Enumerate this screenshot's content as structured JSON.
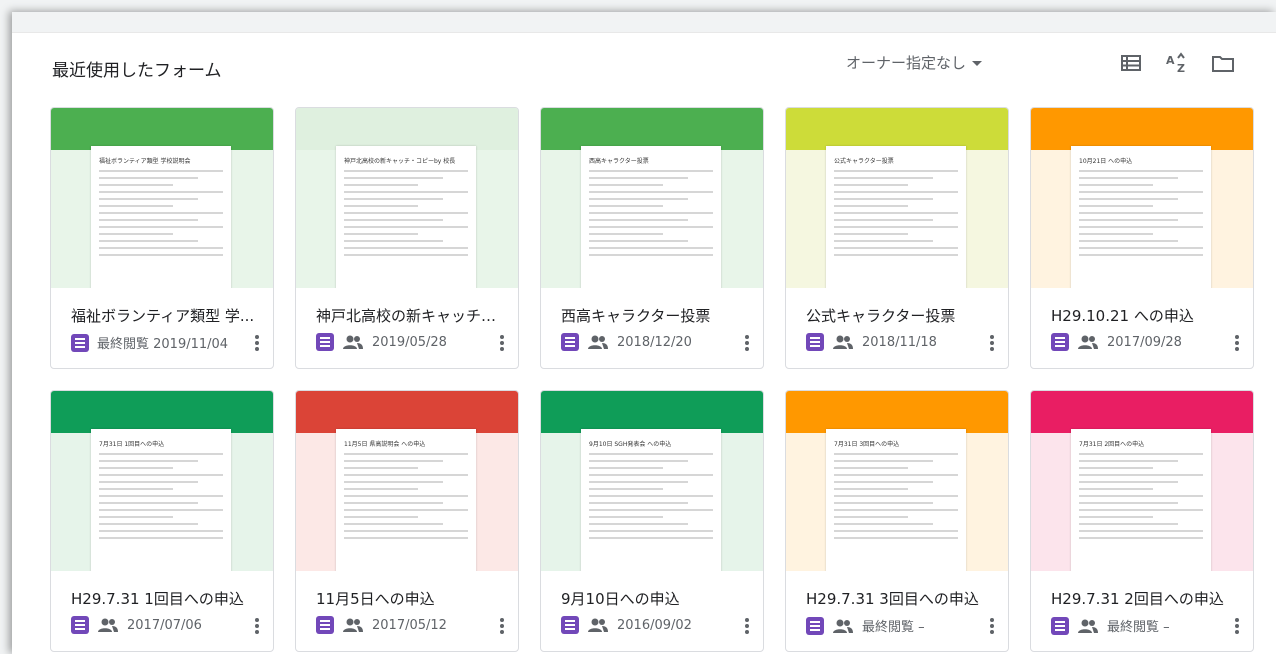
{
  "header": {
    "section_title": "最近使用したフォーム",
    "owner_filter": "オーナー指定なし"
  },
  "toolbar": {
    "icons": [
      "list-view-icon",
      "sort-az-icon",
      "folder-icon"
    ]
  },
  "forms": [
    {
      "title": "福祉ボランティア類型 学...",
      "date": "最終閲覧 2019/11/04",
      "shared": false,
      "accent": "#4caf50",
      "bg": "#e8f5e9",
      "thumb_title": "福祉ボランティア類型 学校説明会"
    },
    {
      "title": "神戸北高校の新キャッチ・...",
      "date": "2019/05/28",
      "shared": true,
      "accent": "#dff0df",
      "bg": "#e8f5e9",
      "thumb_title": "神戸北高校の新キャッチ・コピーby 校長"
    },
    {
      "title": "西高キャラクター投票",
      "date": "2018/12/20",
      "shared": true,
      "accent": "#4caf50",
      "bg": "#e8f5e9",
      "thumb_title": "西高キャラクター投票"
    },
    {
      "title": "公式キャラクター投票",
      "date": "2018/11/18",
      "shared": true,
      "accent": "#cddc39",
      "bg": "#f5f7e0",
      "thumb_title": "公式キャラクター投票"
    },
    {
      "title": "H29.10.21 への申込",
      "date": "2017/09/28",
      "shared": true,
      "accent": "#ff9800",
      "bg": "#fff3e0",
      "thumb_title": "10月21日 への申込"
    },
    {
      "title": "H29.7.31 1回目への申込",
      "date": "2017/07/06",
      "shared": true,
      "accent": "#0f9d58",
      "bg": "#e6f4ea",
      "thumb_title": "7月31日 1回目への申込"
    },
    {
      "title": "11月5日への申込",
      "date": "2017/05/12",
      "shared": true,
      "accent": "#db4437",
      "bg": "#fce8e6",
      "thumb_title": "11月5日 県高説明会 への申込"
    },
    {
      "title": "9月10日への申込",
      "date": "2016/09/02",
      "shared": true,
      "accent": "#0f9d58",
      "bg": "#e6f4ea",
      "thumb_title": "9月10日 SGH発表会 への申込"
    },
    {
      "title": "H29.7.31 3回目への申込",
      "date": "最終閲覧 –",
      "shared": true,
      "accent": "#ff9800",
      "bg": "#fff3e0",
      "thumb_title": "7月31日 3回目への申込"
    },
    {
      "title": "H29.7.31 2回目への申込",
      "date": "最終閲覧 –",
      "shared": true,
      "accent": "#e91e63",
      "bg": "#fce4ec",
      "thumb_title": "7月31日 2回目への申込"
    }
  ]
}
